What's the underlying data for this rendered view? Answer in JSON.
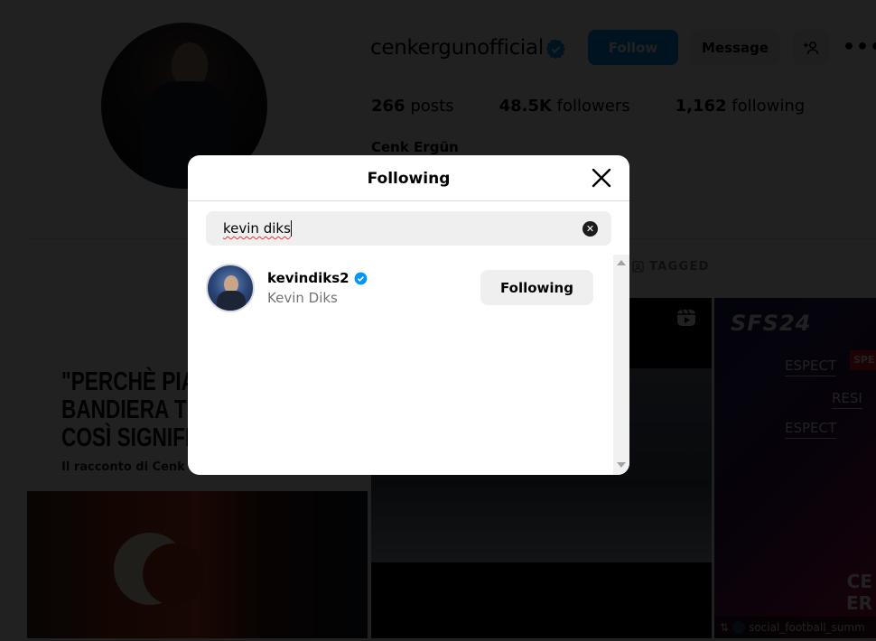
{
  "profile": {
    "username": "cenkergunofficial",
    "verified": true,
    "follow_label": "Follow",
    "message_label": "Message",
    "add_user_icon": "add-person-icon",
    "more_icon": "more-options-icon",
    "stats": {
      "posts_count": "266",
      "posts_label": "posts",
      "followers_count": "48.5K",
      "followers_label": "followers",
      "following_count": "1,162",
      "following_label": "following"
    },
    "full_name": "Cenk Ergün"
  },
  "tabs": {
    "tagged_label": "TAGGED",
    "tagged_icon": "tagged-person-icon"
  },
  "posts": [
    {
      "headline": "\"PERCHÈ PIAN BANDIERA TU COSÌ SIGNIFIC",
      "headline_lines": [
        "\"PERCHÈ PIAN",
        "BANDIERA TU",
        "COSÌ SIGNIFIC"
      ],
      "subtitle": "Il racconto di Cenk"
    },
    {
      "type_icon": "reels-icon"
    },
    {
      "logo": "SFS24",
      "respect_lines": [
        "ESPECT",
        "RESI",
        "ESPECT"
      ],
      "badge": "SPE",
      "name_lines": [
        "CE",
        "ER"
      ],
      "repost_icon": "repost-icon",
      "footer_user": "social_football_summ"
    }
  ],
  "modal": {
    "title": "Following",
    "close_icon": "close-icon",
    "search": {
      "value": "kevin diks",
      "clear_icon": "clear-search-icon"
    },
    "results": [
      {
        "username": "kevindiks2",
        "verified": true,
        "full_name": "Kevin Diks",
        "button_label": "Following"
      }
    ]
  },
  "colors": {
    "accent": "#0095f6",
    "verified_badge": "#0095f6",
    "secondary_text": "#737373",
    "button_bg": "#efefef",
    "overlay": "rgba(0,0,0,0.87)"
  }
}
